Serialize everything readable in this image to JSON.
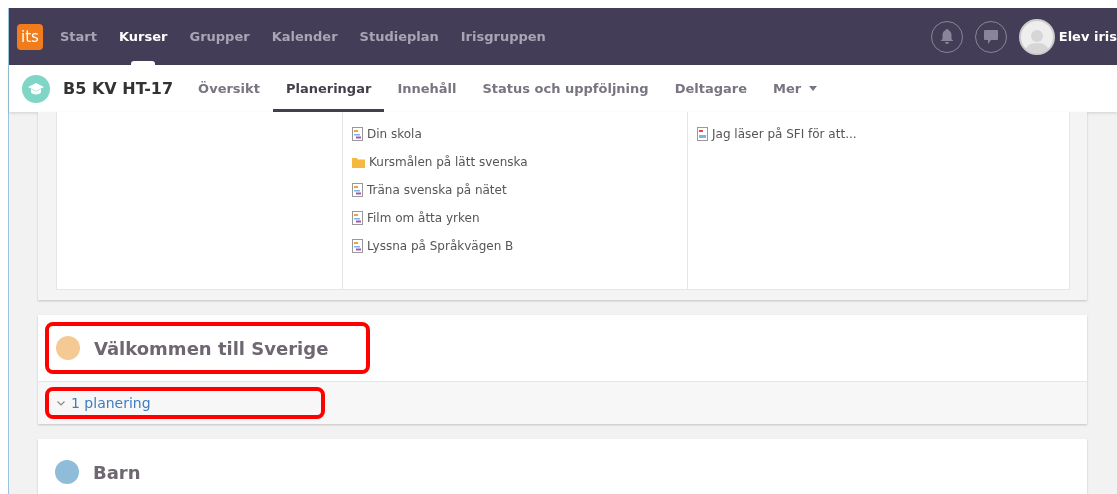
{
  "topnav": {
    "logo": "its",
    "items": [
      {
        "label": "Start",
        "selected": false
      },
      {
        "label": "Kurser",
        "selected": true
      },
      {
        "label": "Grupper",
        "selected": false
      },
      {
        "label": "Kalender",
        "selected": false
      },
      {
        "label": "Studieplan",
        "selected": false
      },
      {
        "label": "Irisgruppen",
        "selected": false
      }
    ],
    "user": "Elev iris"
  },
  "course": {
    "title": "B5 KV HT-17",
    "tabs": [
      {
        "label": "Översikt",
        "selected": false
      },
      {
        "label": "Planeringar",
        "selected": true
      },
      {
        "label": "Innehåll",
        "selected": false
      },
      {
        "label": "Status och uppföljning",
        "selected": false
      },
      {
        "label": "Deltagare",
        "selected": false
      },
      {
        "label": "Mer",
        "selected": false,
        "dropdown": true
      }
    ]
  },
  "resources": {
    "column_2": [
      {
        "kind": "doc",
        "label": "Din skola"
      },
      {
        "kind": "folder",
        "label": "Kursmålen på lätt svenska"
      },
      {
        "kind": "doc",
        "label": "Träna svenska på nätet"
      },
      {
        "kind": "doc",
        "label": "Film om åtta yrken"
      },
      {
        "kind": "doc",
        "label": "Lyssna på Språkvägen B"
      }
    ],
    "column_3": [
      {
        "kind": "pdf",
        "label": "Jag läser på SFI för att..."
      }
    ]
  },
  "sections": [
    {
      "title": "Välkommen till Sverige",
      "color": "#f5c993",
      "highlighted": true,
      "footer": "1 planering"
    },
    {
      "title": "Barn",
      "color": "#8fbcd9",
      "highlighted": false
    }
  ]
}
